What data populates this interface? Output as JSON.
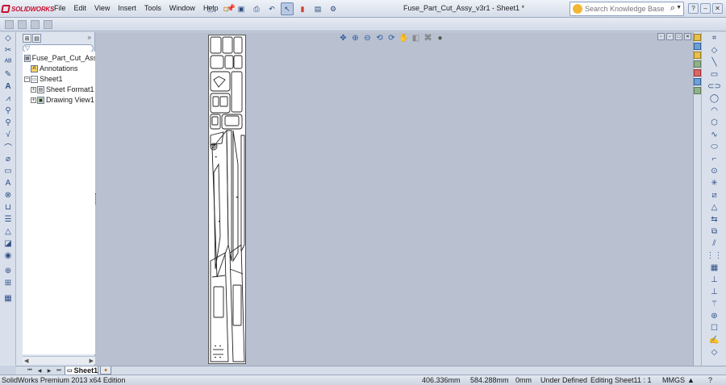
{
  "app": {
    "logo_text": "SOLIDWORKS",
    "document_title": "Fuse_Part_Cut_Assy_v3r1 - Sheet1 *"
  },
  "menu": {
    "items": [
      "File",
      "Edit",
      "View",
      "Insert",
      "Tools",
      "Window",
      "Help"
    ],
    "pin_icon": "pin-icon"
  },
  "search": {
    "placeholder": "Search Knowledge Base"
  },
  "feature_manager": {
    "collapse_glyph": "»",
    "tree": [
      {
        "label": "Fuse_Part_Cut_Assy_v",
        "icon": "drawing-icon"
      },
      {
        "label": "Annotations",
        "icon": "annotations-folder-icon"
      },
      {
        "label": "Sheet1",
        "icon": "sheet-icon"
      },
      {
        "label": "Sheet Format1",
        "icon": "sheet-format-icon"
      },
      {
        "label": "Drawing View1",
        "icon": "drawing-view-icon"
      }
    ],
    "expanders": {
      "sheet1": "−",
      "sheet_format": "+",
      "drawing_view": "+"
    }
  },
  "sheet_tabs": {
    "active_tab": "Sheet1",
    "add_tab_icon": "add-sheet-icon"
  },
  "status_bar": {
    "product": "SolidWorks Premium 2013 x64 Edition",
    "x_coord": "406.336mm",
    "y_coord": "584.288mm",
    "z_coord": "0mm",
    "definition": "Under Defined",
    "editing": "Editing Sheet1",
    "scale": "1 : 1",
    "units": "MMGS",
    "units_dropdown_glyph": "▲"
  },
  "colors": {
    "brand_red": "#c8102e",
    "graphics_bg": "#b9c0cf",
    "toolbar_bg": "#d9e0eb"
  }
}
